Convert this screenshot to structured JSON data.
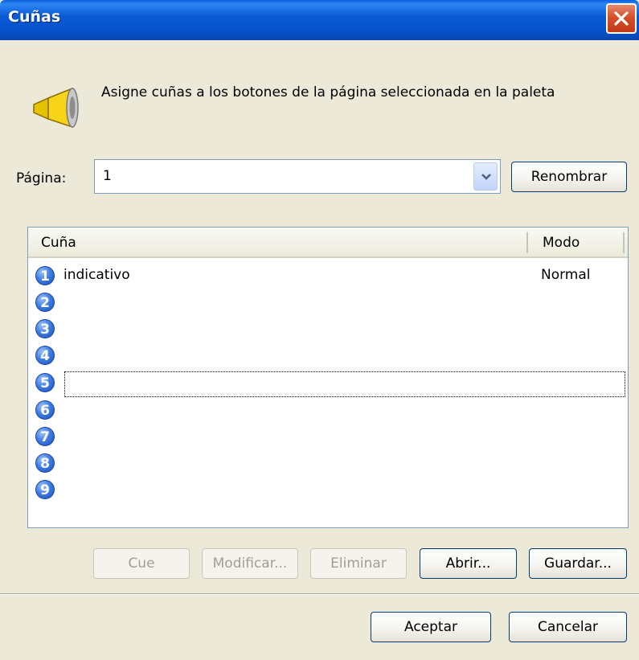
{
  "window": {
    "title": "Cuñas"
  },
  "description": "Asigne cuñas a los botones de la página seleccionada en la paleta",
  "page": {
    "label": "Página:",
    "value": "1",
    "rename_label": "Renombrar"
  },
  "list": {
    "columns": [
      "Cuña",
      "Modo"
    ],
    "rows": [
      {
        "num": "1",
        "cue": "indicativo",
        "mode": "Normal"
      },
      {
        "num": "2",
        "cue": "",
        "mode": ""
      },
      {
        "num": "3",
        "cue": "",
        "mode": ""
      },
      {
        "num": "4",
        "cue": "",
        "mode": ""
      },
      {
        "num": "5",
        "cue": "",
        "mode": ""
      },
      {
        "num": "6",
        "cue": "",
        "mode": ""
      },
      {
        "num": "7",
        "cue": "",
        "mode": ""
      },
      {
        "num": "8",
        "cue": "",
        "mode": ""
      },
      {
        "num": "9",
        "cue": "",
        "mode": ""
      }
    ]
  },
  "buttons": {
    "cue": "Cue",
    "modify": "Modificar...",
    "delete": "Eliminar",
    "open": "Abrir...",
    "save": "Guardar...",
    "accept": "Aceptar",
    "cancel": "Cancelar"
  },
  "colors": {
    "titlebar": "#0a5ad6",
    "dialog_bg": "#ece9d8",
    "number_badge": "#3f7de3",
    "close_button": "#d6502a"
  }
}
